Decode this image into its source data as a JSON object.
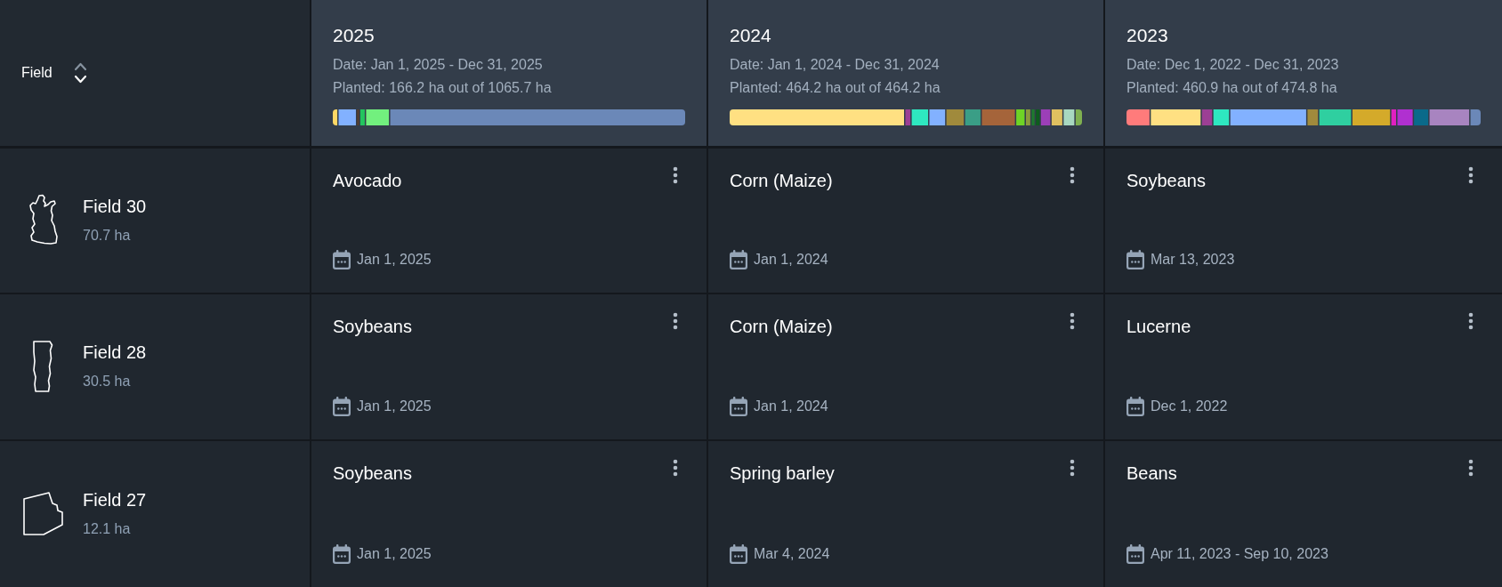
{
  "field_header": {
    "label": "Field",
    "sort_descending": true
  },
  "seasons": [
    {
      "year": "2025",
      "date": "Date: Jan 1, 2025 - Dec 31, 2025",
      "planted": "Planted: 166.2 ha out of 1065.7 ha"
    },
    {
      "year": "2024",
      "date": "Date: Jan 1, 2024 - Dec 31, 2024",
      "planted": "Planted: 464.2 ha out of 464.2 ha"
    },
    {
      "year": "2023",
      "date": "Date: Dec 1, 2022 - Dec 31, 2023",
      "planted": "Planted: 460.9 ha out of 474.8 ha"
    }
  ],
  "fields": [
    {
      "name": "Field 30",
      "area": "70.7 ha",
      "crops": [
        {
          "name": "Avocado",
          "date": "Jan 1, 2025"
        },
        {
          "name": "Corn (Maize)",
          "date": "Jan 1, 2024"
        },
        {
          "name": "Soybeans",
          "date": "Mar 13, 2023"
        }
      ]
    },
    {
      "name": "Field 28",
      "area": "30.5 ha",
      "crops": [
        {
          "name": "Soybeans",
          "date": "Jan 1, 2025"
        },
        {
          "name": "Corn (Maize)",
          "date": "Jan 1, 2024"
        },
        {
          "name": "Lucerne",
          "date": "Dec 1, 2022"
        }
      ]
    },
    {
      "name": "Field 27",
      "area": "12.1 ha",
      "crops": [
        {
          "name": "Soybeans",
          "date": "Jan 1, 2025"
        },
        {
          "name": "Spring barley",
          "date": "Mar 4, 2024"
        },
        {
          "name": "Beans",
          "date": "Apr 11, 2023 - Sep 10, 2023"
        }
      ]
    }
  ]
}
